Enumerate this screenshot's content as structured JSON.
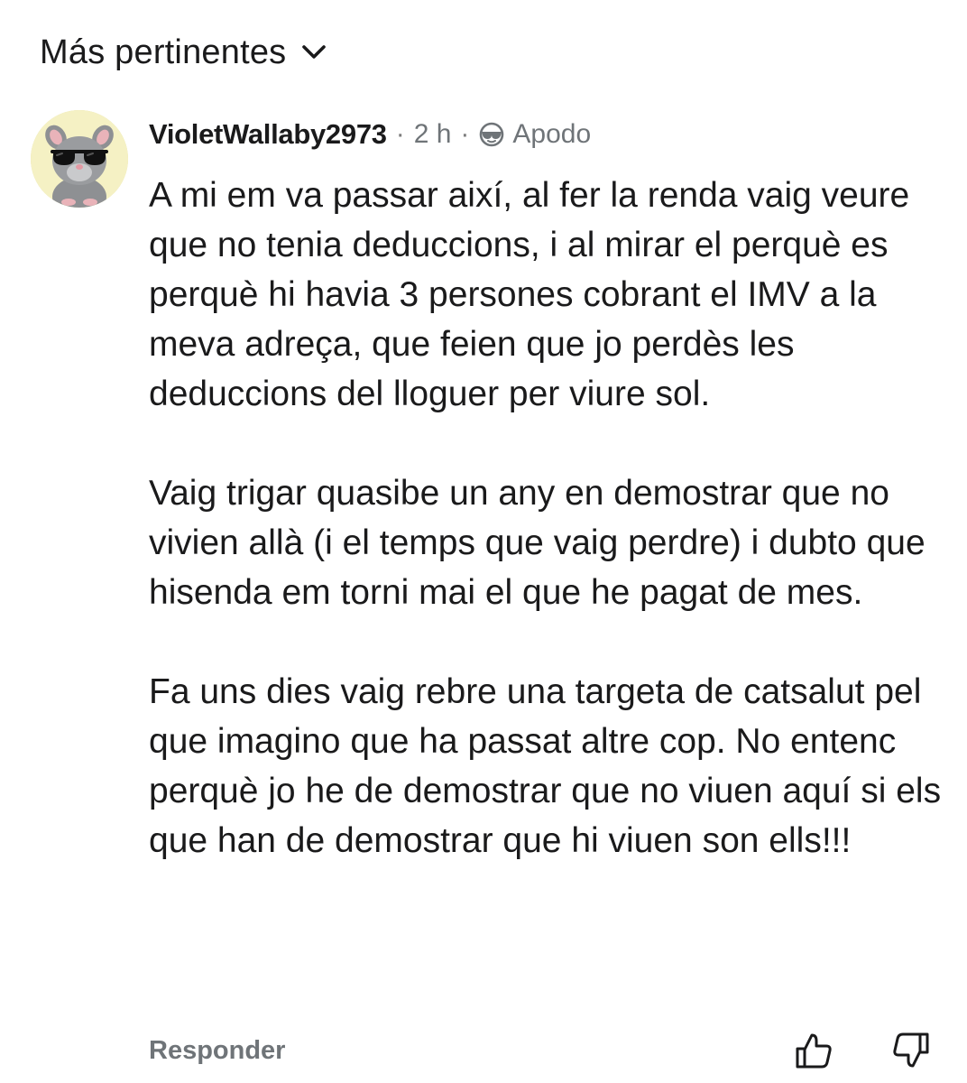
{
  "sort": {
    "label": "Más pertinentes",
    "icon": "chevron-down-icon"
  },
  "comment": {
    "avatar_icon": "avatar-animal-sunglasses",
    "username": "VioletWallaby2973",
    "separator": "·",
    "timestamp": "2 h",
    "flair_icon": "sunglasses-icon",
    "flair": "Apodo",
    "paragraphs": [
      "A mi em va passar així, al fer la renda vaig veure que no tenia deduccions, i al mirar el perquè es perquè hi havia 3 persones cobrant el IMV a la meva adreça, que feien que jo perdès les deduccions del lloguer per viure sol.",
      "Vaig trigar quasibe un any en demostrar que no vivien allà (i el temps que vaig perdre) i dubto que hisenda em torni mai el que he pagat de mes.",
      "Fa uns dies vaig rebre una targeta de catsalut pel que imagino que ha passat altre cop. No entenc perquè jo he de demostrar que no viuen aquí si els que han de demostrar que hi viuen son ells!!!"
    ]
  },
  "actions": {
    "reply_label": "Responder",
    "upvote_icon": "thumbs-up-icon",
    "downvote_icon": "thumbs-down-icon"
  },
  "colors": {
    "text": "#1a1a1b",
    "meta": "#6f7478",
    "avatar_bg": "#f5f1c4"
  }
}
